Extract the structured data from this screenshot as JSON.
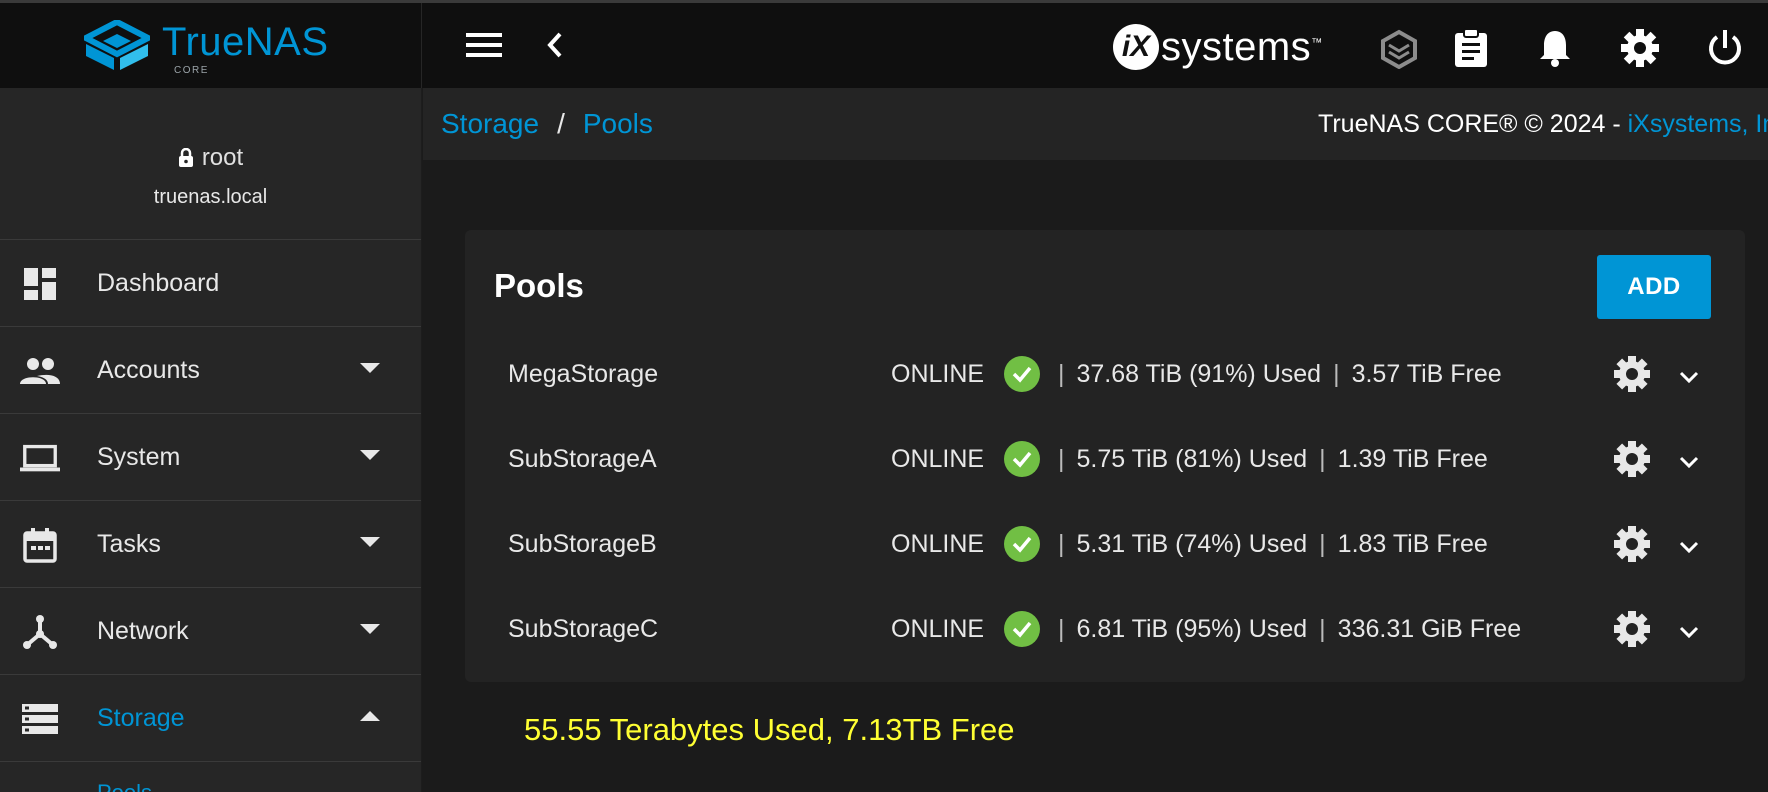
{
  "app": {
    "brand": "TrueNAS",
    "edition": "CORE",
    "vendor_logo_letters": "iX",
    "vendor_logo_word": "systems",
    "vendor_logo_tm": "™"
  },
  "user": {
    "name": "root",
    "host": "truenas.local"
  },
  "sidebar": {
    "items": [
      {
        "label": "Dashboard",
        "icon": "dashboard-icon",
        "expandable": false
      },
      {
        "label": "Accounts",
        "icon": "people-icon",
        "expandable": true
      },
      {
        "label": "System",
        "icon": "laptop-icon",
        "expandable": true
      },
      {
        "label": "Tasks",
        "icon": "calendar-icon",
        "expandable": true
      },
      {
        "label": "Network",
        "icon": "network-icon",
        "expandable": true
      },
      {
        "label": "Storage",
        "icon": "storage-icon",
        "expandable": true,
        "active": true
      }
    ],
    "sub_item_partial": "Pools"
  },
  "breadcrumb": {
    "items": [
      "Storage",
      "Pools"
    ],
    "separator": "/"
  },
  "footer_copyright": {
    "text": "TrueNAS CORE® © 2024 - ",
    "link": "iXsystems, Inc"
  },
  "pools_card": {
    "title": "Pools",
    "add_label": "ADD",
    "pools": [
      {
        "name": "MegaStorage",
        "status": "ONLINE",
        "used": "37.68 TiB (91%) Used",
        "free": "3.57 TiB Free"
      },
      {
        "name": "SubStorageA",
        "status": "ONLINE",
        "used": "5.75 TiB (81%) Used",
        "free": "1.39 TiB Free"
      },
      {
        "name": "SubStorageB",
        "status": "ONLINE",
        "used": "5.31 TiB (74%) Used",
        "free": "1.83 TiB Free"
      },
      {
        "name": "SubStorageC",
        "status": "ONLINE",
        "used": "6.81 TiB (95%) Used",
        "free": "336.31 GiB Free"
      }
    ]
  },
  "summary_text": "55.55 Terabytes Used, 7.13TB Free",
  "colors": {
    "accent": "#0095d5",
    "status_ok": "#71bf44",
    "summary": "#ffff33"
  }
}
